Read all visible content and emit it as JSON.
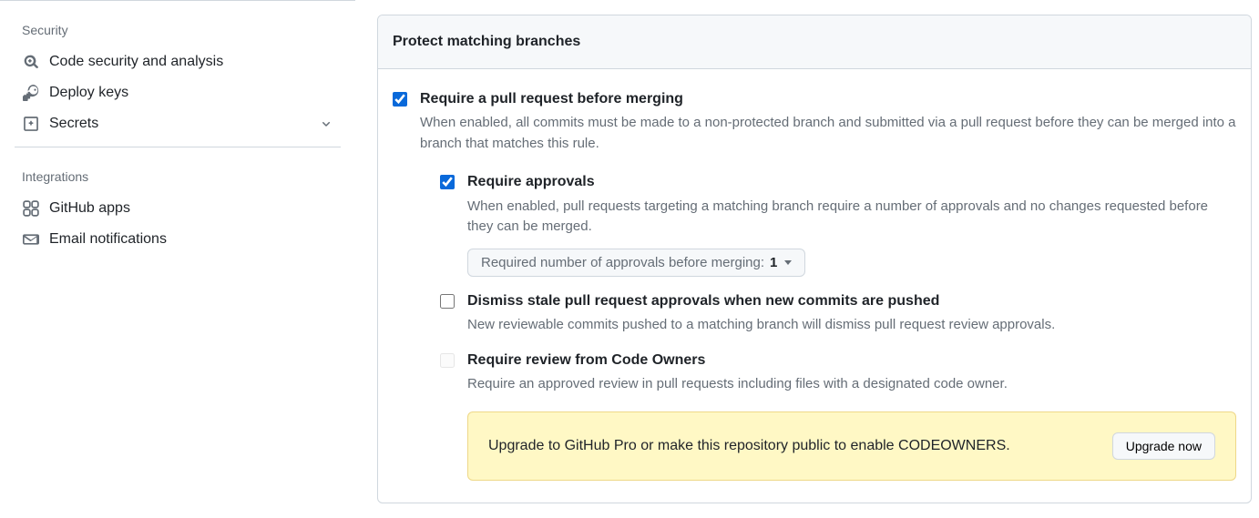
{
  "sidebar": {
    "security_heading": "Security",
    "item_code_security": "Code security and analysis",
    "item_deploy_keys": "Deploy keys",
    "item_secrets": "Secrets",
    "integrations_heading": "Integrations",
    "item_github_apps": "GitHub apps",
    "item_email_notifications": "Email notifications"
  },
  "panel": {
    "heading": "Protect matching branches",
    "require_pr": {
      "title": "Require a pull request before merging",
      "desc": "When enabled, all commits must be made to a non-protected branch and submitted via a pull request before they can be merged into a branch that matches this rule."
    },
    "require_approvals": {
      "title": "Require approvals",
      "desc": "When enabled, pull requests targeting a matching branch require a number of approvals and no changes requested before they can be merged.",
      "dropdown_prefix": "Required number of approvals before merging: ",
      "dropdown_value": "1"
    },
    "dismiss_stale": {
      "title": "Dismiss stale pull request approvals when new commits are pushed",
      "desc": "New reviewable commits pushed to a matching branch will dismiss pull request review approvals."
    },
    "code_owners": {
      "title": "Require review from Code Owners",
      "desc": "Require an approved review in pull requests including files with a designated code owner."
    },
    "upsell_text": "Upgrade to GitHub Pro or make this repository public to enable CODEOWNERS.",
    "upgrade_button": "Upgrade now"
  }
}
